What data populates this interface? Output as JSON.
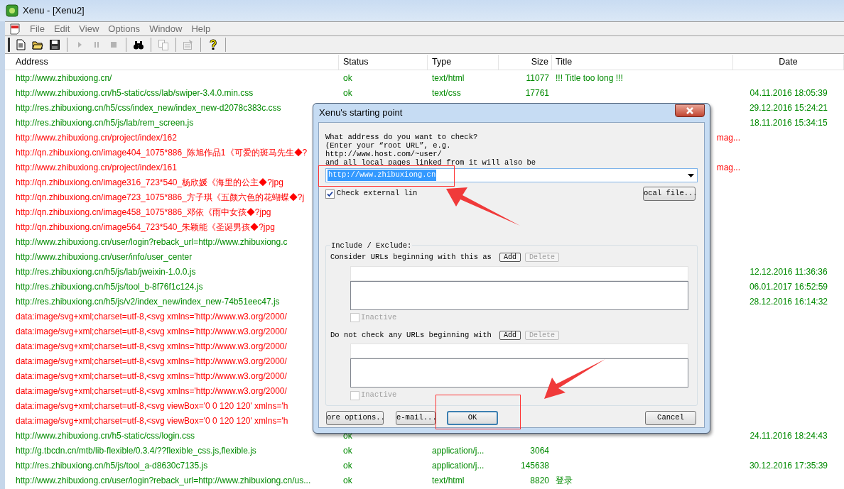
{
  "window": {
    "title": "Xenu - [Xenu2]"
  },
  "menu": [
    "File",
    "Edit",
    "View",
    "Options",
    "Window",
    "Help"
  ],
  "toolbar": [
    {
      "kind": "new",
      "disabled": false
    },
    {
      "kind": "open",
      "disabled": false
    },
    {
      "kind": "save",
      "disabled": false
    },
    {
      "kind": "play",
      "disabled": true
    },
    {
      "kind": "pause",
      "disabled": true
    },
    {
      "kind": "stop",
      "disabled": true
    },
    {
      "kind": "find",
      "disabled": false
    },
    {
      "kind": "copy",
      "disabled": true
    },
    {
      "kind": "properties",
      "disabled": true
    },
    {
      "kind": "help",
      "disabled": false
    }
  ],
  "columns": [
    "Address",
    "Status",
    "Type",
    "Size",
    "Title",
    "Date"
  ],
  "rows": [
    {
      "broken": false,
      "address": "http://www.zhibuxiong.cn/",
      "status": "ok",
      "type": "text/html",
      "size": "11077",
      "title": "!!! Title too long !!!"
    },
    {
      "broken": false,
      "address": "http://www.zhibuxiong.cn/h5-static/css/lab/swiper-3.4.0.min.css",
      "status": "ok",
      "type": "text/css",
      "size": "17761",
      "date": "04.11.2016  18:05:39"
    },
    {
      "broken": false,
      "address": "http://res.zhibuxiong.cn/h5/css/index_new/index_new-d2078c383c.css",
      "date": "29.12.2016  15:24:21"
    },
    {
      "broken": false,
      "address": "http://res.zhibuxiong.cn/h5/js/lab/rem_screen.js",
      "date": "18.11.2016  15:34:15"
    },
    {
      "broken": true,
      "address": "http://www.zhibuxiong.cn/project/index/162",
      "title": "mag..."
    },
    {
      "broken": true,
      "address": "http://qn.zhibuxiong.cn/image404_1075*886_陈旭作品1《可爱的斑马先生◆?"
    },
    {
      "broken": true,
      "address": "http://www.zhibuxiong.cn/project/index/161",
      "title": "mag..."
    },
    {
      "broken": true,
      "address": "http://qn.zhibuxiong.cn/image316_723*540_杨欣媛《海里的公主◆?jpg"
    },
    {
      "broken": true,
      "address": "http://qn.zhibuxiong.cn/image723_1075*886_方子琪《五颜六色的花蝴蝶◆?j"
    },
    {
      "broken": true,
      "address": "http://qn.zhibuxiong.cn/image458_1075*886_邓依《雨中女孩◆?jpg"
    },
    {
      "broken": true,
      "address": "http://qn.zhibuxiong.cn/image564_723*540_朱颖能《圣诞男孩◆?jpg"
    },
    {
      "broken": false,
      "address": "http://www.zhibuxiong.cn/user/login?reback_url=http://www.zhibuxiong.c"
    },
    {
      "broken": false,
      "address": "http://www.zhibuxiong.cn/user/info/user_center"
    },
    {
      "broken": false,
      "address": "http://res.zhibuxiong.cn/h5/js/lab/jweixin-1.0.0.js",
      "date": "12.12.2016  11:36:36"
    },
    {
      "broken": false,
      "address": "http://res.zhibuxiong.cn/h5/js/tool_b-8f76f1c124.js",
      "date": "06.01.2017  16:52:59"
    },
    {
      "broken": false,
      "address": "http://res.zhibuxiong.cn/h5/js/v2/index_new/index_new-74b51eec47.js",
      "date": "28.12.2016  16:14:32"
    },
    {
      "broken": true,
      "address": "data:image/svg+xml;charset=utf-8,<svg xmlns='http://www.w3.org/2000/"
    },
    {
      "broken": true,
      "address": "data:image/svg+xml;charset=utf-8,<svg xmlns='http://www.w3.org/2000/"
    },
    {
      "broken": true,
      "address": "data:image/svg+xml;charset=utf-8,<svg xmlns='http://www.w3.org/2000/"
    },
    {
      "broken": true,
      "address": "data:image/svg+xml;charset=utf-8,<svg xmlns='http://www.w3.org/2000/"
    },
    {
      "broken": true,
      "address": "data:image/svg+xml;charset=utf-8,<svg xmlns='http://www.w3.org/2000/"
    },
    {
      "broken": true,
      "address": "data:image/svg+xml;charset=utf-8,<svg xmlns='http://www.w3.org/2000/"
    },
    {
      "broken": true,
      "address": "data:image/svg+xml;charset=utf-8,<svg viewBox='0 0 120 120' xmlns='h"
    },
    {
      "broken": true,
      "address": "data:image/svg+xml;charset=utf-8,<svg viewBox='0 0 120 120' xmlns='h"
    },
    {
      "broken": false,
      "address": "http://www.zhibuxiong.cn/h5-static/css/login.css",
      "status": "ok",
      "date": "24.11.2016  18:24:43"
    },
    {
      "broken": false,
      "address": "http://g.tbcdn.cn/mtb/lib-flexible/0.3.4/??flexible_css.js,flexible.js",
      "status": "ok",
      "type": "application/j...",
      "size": "3064"
    },
    {
      "broken": false,
      "address": "http://res.zhibuxiong.cn/h5/js/tool_a-d8630c7135.js",
      "status": "ok",
      "type": "application/j...",
      "size": "145638",
      "date": "30.12.2016  17:35:39"
    },
    {
      "broken": false,
      "address": "http://www.zhibuxiong.cn/user/login?reback_url=http://www.zhibuxiong.cn/us...",
      "status": "ok",
      "type": "text/html",
      "size": "8820",
      "title": "登录"
    }
  ],
  "dialog": {
    "title": "Xenu's starting point",
    "prompt": [
      "What address do you want to check?",
      "(Enter your “root URL”, e.g.",
      "http://www.host.com/~user/",
      "and all local pages linked from it will also be"
    ],
    "url": {
      "value": "http://www.zhibuxiong.cn",
      "selected": true
    },
    "check_external": {
      "label": "Check external lin",
      "checked": true
    },
    "local_file_button": "ocal file...",
    "group_label": "Include / Exclude:",
    "sections": [
      {
        "label": "Consider URLs beginning with this as",
        "add": {
          "label": "Add",
          "disabled": false
        },
        "delete": {
          "label": "Delete",
          "disabled": true
        },
        "inactive": {
          "label": "Inactive",
          "checked": false,
          "disabled": true
        }
      },
      {
        "label": "Do not check any URLs beginning with",
        "add": {
          "label": "Add",
          "disabled": false
        },
        "delete": {
          "label": "Delete",
          "disabled": true
        },
        "inactive": {
          "label": "Inactive",
          "checked": false,
          "disabled": true
        }
      }
    ],
    "buttons": [
      {
        "label": "ore options..",
        "default": false
      },
      {
        "label": "e-mail...",
        "default": false
      },
      {
        "label": "OK",
        "default": true
      },
      {
        "label": "Cancel",
        "default": false
      }
    ]
  }
}
